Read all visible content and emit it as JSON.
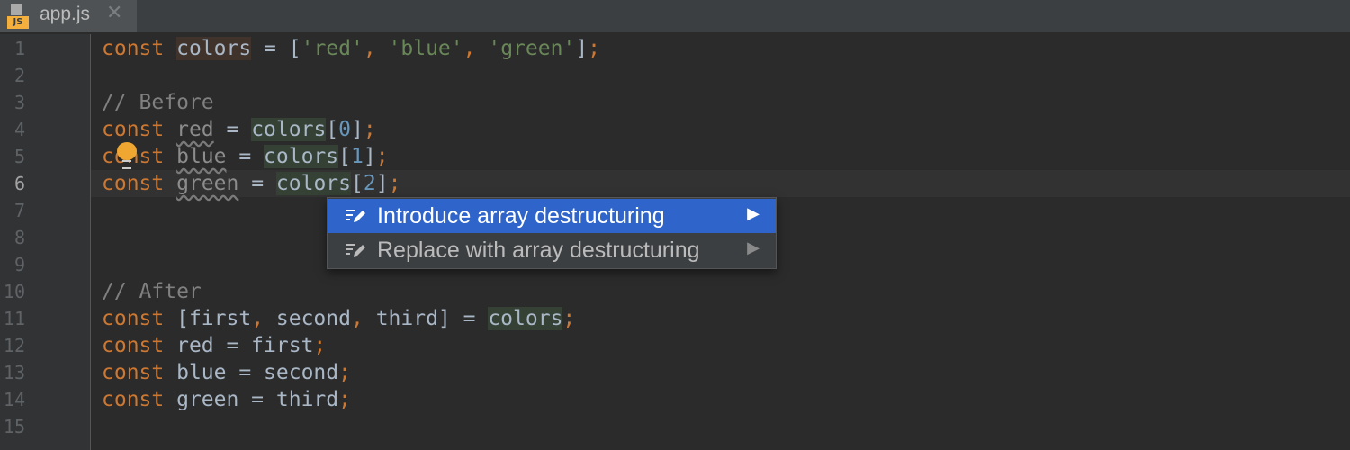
{
  "tabs": [
    {
      "label": "app.js",
      "icon": "javascript-file-icon",
      "icon_badge": "JS",
      "close": "✕"
    }
  ],
  "gutter": {
    "line_numbers": [
      "1",
      "2",
      "3",
      "4",
      "5",
      "6",
      "7",
      "8",
      "9",
      "10",
      "11",
      "12",
      "13",
      "14",
      "15"
    ],
    "current_line": "6"
  },
  "code": {
    "line1": {
      "kw": "const",
      "var": "colors",
      "eq": " = [",
      "s1": "'red'",
      "c1": ", ",
      "s2": "'blue'",
      "c2": ", ",
      "s3": "'green'",
      "end": "]",
      "semi": ";"
    },
    "line3": {
      "comment": "// Before"
    },
    "line4": {
      "kw": "const",
      "var": "red",
      "eq": " = ",
      "obj": "colors",
      "open": "[",
      "idx": "0",
      "close": "]",
      "semi": ";"
    },
    "line5": {
      "kw": "const",
      "var": "blue",
      "eq": " = ",
      "obj": "colors",
      "open": "[",
      "idx": "1",
      "close": "]",
      "semi": ";"
    },
    "line6": {
      "kw": "const",
      "var": "green",
      "eq": " = ",
      "obj": "colors",
      "open": "[",
      "idx": "2",
      "close": "]",
      "semi": ";"
    },
    "line10": {
      "comment": "// After"
    },
    "line11": {
      "kw": "const",
      "open": " [first",
      "c1": ",",
      "second": " second",
      "c2": ",",
      "third": " third] = ",
      "obj": "colors",
      "semi": ";"
    },
    "line12": {
      "kw": "const",
      "rest": " red = first",
      "semi": ";"
    },
    "line13": {
      "kw": "const",
      "rest": " blue = second",
      "semi": ";"
    },
    "line14": {
      "kw": "const",
      "rest": " green = third",
      "semi": ";"
    }
  },
  "intention_bulb": {
    "icon": "lightbulb-icon",
    "color": "#f0a732"
  },
  "popup": {
    "items": [
      {
        "label": "Introduce array destructuring",
        "icon": "edit-intention-icon",
        "arrow": "▶",
        "selected": true
      },
      {
        "label": "Replace with array destructuring",
        "icon": "edit-intention-icon",
        "arrow": "▶",
        "selected": false
      }
    ]
  },
  "colors": {
    "keyword": "#cc7832",
    "string": "#6a8759",
    "number": "#6897bb",
    "comment": "#808080",
    "text": "#a9b7c6",
    "selection": "#2f65ca",
    "background": "#2b2b2b"
  }
}
